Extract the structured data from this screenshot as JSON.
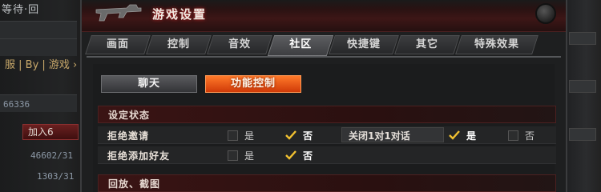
{
  "background": {
    "left_title": "等待·回",
    "left_filter": "服 | By | 游戏 ›",
    "left_numbers": [
      "66336",
      "46602/31",
      "1303/31"
    ],
    "left_button": "加入6"
  },
  "dialog": {
    "title": "游戏设置",
    "tabs": [
      {
        "label": "画面",
        "active": false
      },
      {
        "label": "控制",
        "active": false
      },
      {
        "label": "音效",
        "active": false
      },
      {
        "label": "社区",
        "active": true
      },
      {
        "label": "快捷键",
        "active": false
      },
      {
        "label": "其它",
        "active": false
      },
      {
        "label": "特殊效果",
        "active": false
      }
    ],
    "sub_buttons": {
      "chat": "聊天",
      "function_control": "功能控制"
    },
    "sections": {
      "status": "设定状态",
      "next": "回放、截图"
    },
    "rows": [
      {
        "label": "拒绝邀请",
        "yes_label": "是",
        "yes_checked": false,
        "no_label": "否",
        "no_checked": true,
        "extra": {
          "label": "关闭1对1对话",
          "yes_label": "是",
          "yes_checked": true,
          "no_label": "否",
          "no_checked": false
        }
      },
      {
        "label": "拒绝添加好友",
        "yes_label": "是",
        "yes_checked": false,
        "no_label": "否",
        "no_checked": true
      }
    ]
  },
  "colors": {
    "accent_orange": "#e8551a",
    "check_yellow": "#f0c030",
    "title_red": "#3d1616"
  },
  "icons": [
    "gun-icon",
    "close-icon",
    "checkmark-icon",
    "checkbox-icon"
  ]
}
